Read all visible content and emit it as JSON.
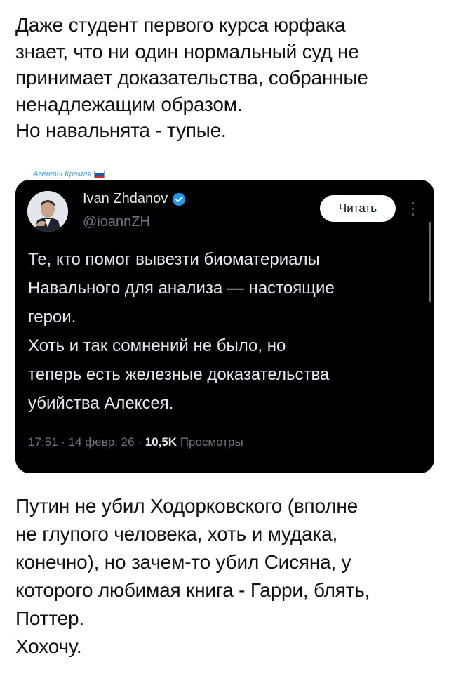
{
  "post_top": {
    "lines": [
      "Даже студент первого курса юрфака",
      "знает, что ни один нормальный суд не",
      "принимает доказательства, собранные",
      "ненадлежащим образом.",
      "Но навальнята - тупые."
    ]
  },
  "watermark": {
    "text": "Агенты Кремля"
  },
  "quoted_tweet": {
    "author_name": "Ivan Zhdanov",
    "handle": "@ioannZH",
    "follow_label": "Читать",
    "body_lines": [
      "Те, кто помог вывезти биоматериалы",
      "Навального для анализа — настоящие",
      "герои.",
      "Хоть и так сомнений не было, но",
      "теперь есть железные доказательства",
      "убийства Алексея."
    ],
    "time": "17:51",
    "date": "14 февр. 26",
    "views_count": "10,5K",
    "views_label": "Просмотры"
  },
  "post_bottom": {
    "lines": [
      "Путин не убил Ходорковского (вполне",
      "не глупого человека, хоть и мудака,",
      "конечно), но зачем-то убил Сисяна, у",
      "которого любимая книга - Гарри, блять,",
      "Поттер.",
      "Хохочу."
    ]
  },
  "colors": {
    "card_background": "#000000",
    "verified_badge": "#1d9bf0",
    "watermark": "#4aa3e0",
    "muted_text": "#71767b"
  }
}
